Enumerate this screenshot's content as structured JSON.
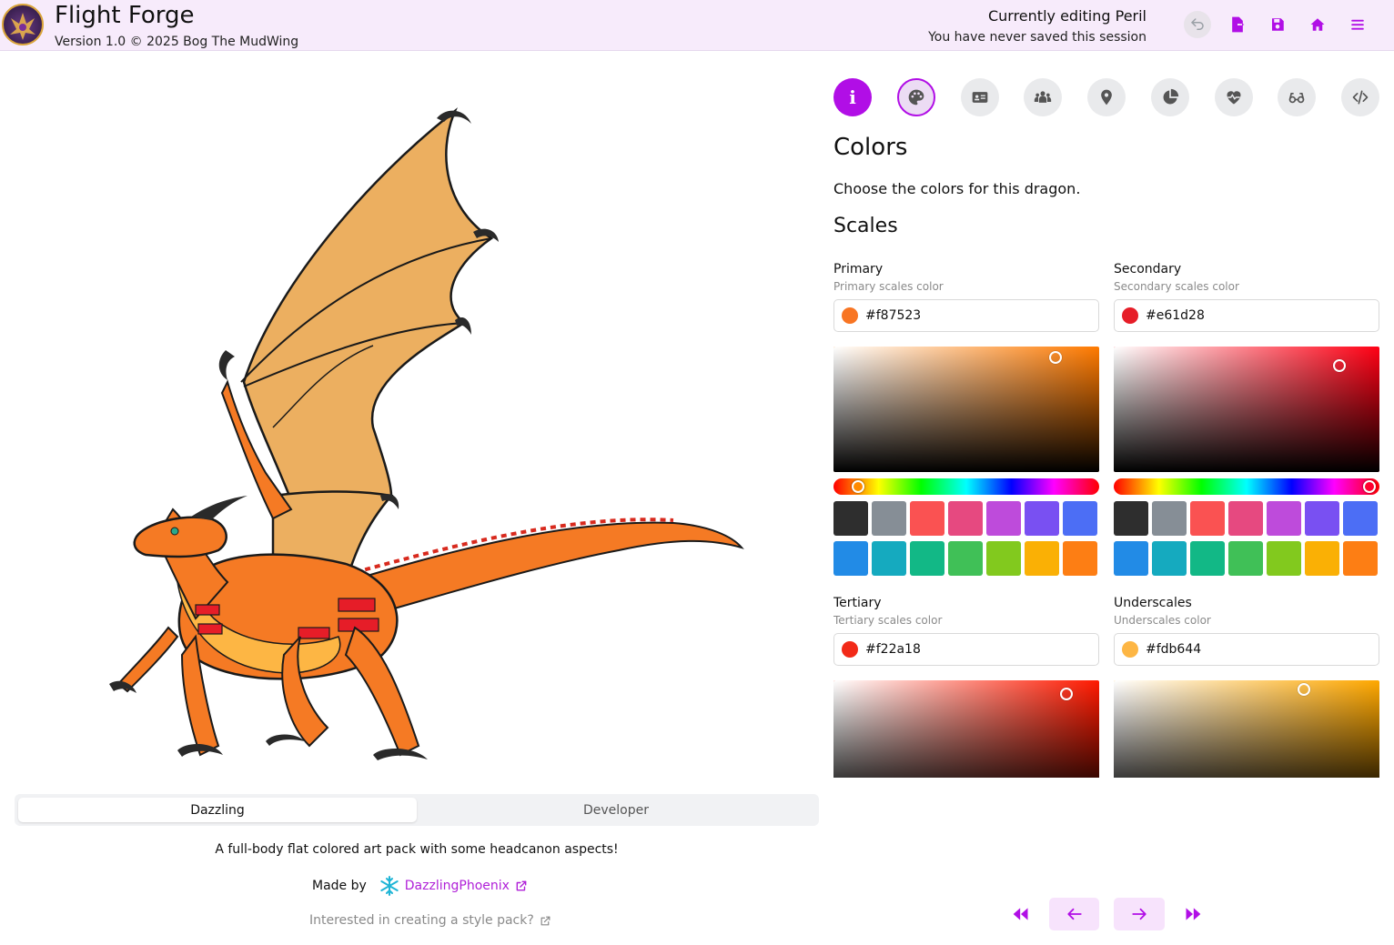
{
  "header": {
    "app_title": "Flight Forge",
    "version": "Version 1.0 © 2025 Bog The MudWing",
    "editing": "Currently editing Peril",
    "saved_status": "You have never saved this session",
    "buttons": [
      {
        "name": "undo",
        "icon": "undo-icon"
      },
      {
        "name": "export",
        "icon": "export-file-icon"
      },
      {
        "name": "save",
        "icon": "save-icon"
      },
      {
        "name": "home",
        "icon": "home-icon"
      },
      {
        "name": "menu",
        "icon": "hamburger-menu-icon"
      }
    ]
  },
  "preview": {
    "tabs": [
      {
        "label": "Dazzling",
        "active": true
      },
      {
        "label": "Developer",
        "active": false
      }
    ],
    "description": "A full-body flat colored art pack with some headcanon aspects!",
    "made_by_label": "Made by",
    "author": "DazzlingPhoenix",
    "style_pack_link": "Interested in creating a style pack?"
  },
  "section_tabs": [
    {
      "name": "info",
      "icon": "info-icon"
    },
    {
      "name": "colors",
      "icon": "palette-icon"
    },
    {
      "name": "identity",
      "icon": "id-card-icon"
    },
    {
      "name": "relationships",
      "icon": "people-icon"
    },
    {
      "name": "location",
      "icon": "map-pin-icon"
    },
    {
      "name": "stats",
      "icon": "pie-chart-icon"
    },
    {
      "name": "health",
      "icon": "heart-pulse-icon"
    },
    {
      "name": "appearance",
      "icon": "glasses-icon"
    },
    {
      "name": "code",
      "icon": "code-icon"
    }
  ],
  "colors_section": {
    "title": "Colors",
    "description": "Choose the colors for this dragon.",
    "group_title": "Scales",
    "pickers": [
      {
        "label": "Primary",
        "sublabel": "Primary scales color",
        "value": "#f87523",
        "hue_color": "#ff7a00",
        "hue": 0.09
      },
      {
        "label": "Secondary",
        "sublabel": "Secondary scales color",
        "value": "#e61d28",
        "hue_color": "#ff0014",
        "hue": 0.99
      },
      {
        "label": "Tertiary",
        "sublabel": "Tertiary scales color",
        "value": "#f22a18",
        "hue_color": "#ff1a00",
        "hue": 0.02
      },
      {
        "label": "Underscales",
        "sublabel": "Underscales color",
        "value": "#fdb644",
        "hue_color": "#ffa800",
        "hue": 0.1
      }
    ],
    "swatches": [
      "#2e2e2e",
      "#868e96",
      "#fa5252",
      "#e64980",
      "#be4bdb",
      "#7950f2",
      "#4c6ef5",
      "#228be6",
      "#15aabf",
      "#12b886",
      "#40c057",
      "#82c91e",
      "#fab005",
      "#fd7e14"
    ]
  },
  "footer_nav": [
    {
      "name": "first",
      "icon": "double-chevron-left-icon"
    },
    {
      "name": "previous",
      "icon": "arrow-left-icon"
    },
    {
      "name": "next",
      "icon": "arrow-right-icon"
    },
    {
      "name": "last",
      "icon": "double-chevron-right-icon"
    }
  ],
  "accent": "#b10ee6"
}
